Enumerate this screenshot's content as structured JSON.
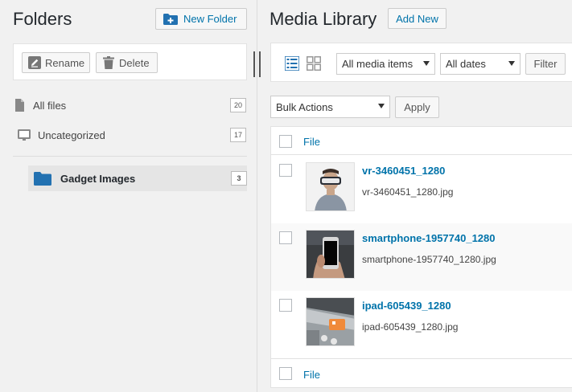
{
  "left": {
    "title": "Folders",
    "new_folder_label": "New Folder",
    "rename_label": "Rename",
    "delete_label": "Delete",
    "tree": [
      {
        "label": "All files",
        "count": "20",
        "icon": "file-icon"
      },
      {
        "label": "Uncategorized",
        "count": "17",
        "icon": "inbox-icon"
      },
      {
        "label": "Gadget Images",
        "count": "3",
        "icon": "folder-icon"
      }
    ]
  },
  "right": {
    "title": "Media Library",
    "add_new_label": "Add New",
    "media_filter": "All media items",
    "date_filter": "All dates",
    "filter_label": "Filter",
    "bulk_actions": "Bulk Actions",
    "apply_label": "Apply",
    "column_file": "File",
    "rows": [
      {
        "title": "vr-3460451_1280",
        "file": "vr-3460451_1280.jpg"
      },
      {
        "title": "smartphone-1957740_1280",
        "file": "smartphone-1957740_1280.jpg"
      },
      {
        "title": "ipad-605439_1280",
        "file": "ipad-605439_1280.jpg"
      }
    ]
  },
  "colors": {
    "accent": "#0073aa",
    "folder": "#2271b1",
    "background": "#f1f1f1"
  }
}
